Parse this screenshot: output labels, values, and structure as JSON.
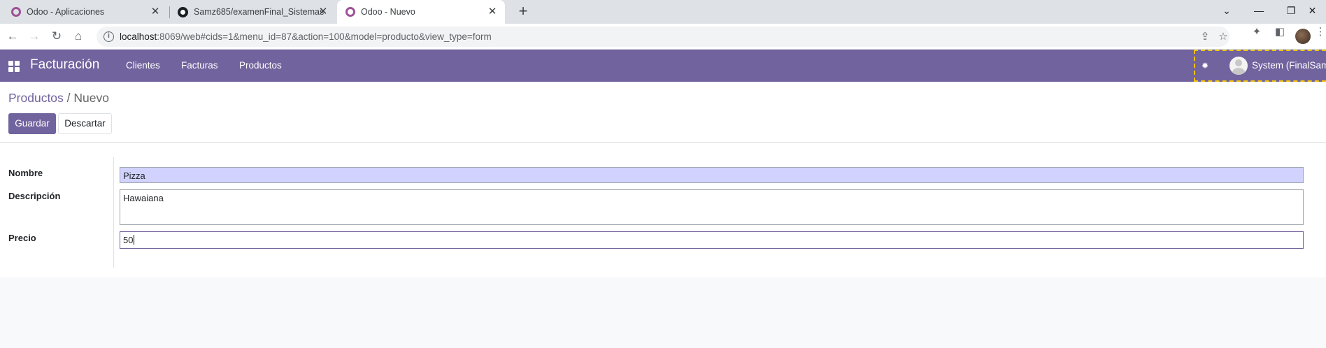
{
  "browser": {
    "tabs": [
      {
        "title": "Odoo - Aplicaciones",
        "favicon": "odoo-icon",
        "active": false
      },
      {
        "title": "Samz685/examenFinal_Sistemas",
        "favicon": "github-icon",
        "active": false
      },
      {
        "title": "Odoo - Nuevo",
        "favicon": "odoo-icon",
        "active": true
      }
    ],
    "url_host": "localhost",
    "url_rest": ":8069/web#cids=1&menu_id=87&action=100&model=producto&view_type=form"
  },
  "odoo": {
    "app_name": "Facturación",
    "menu": [
      "Clientes",
      "Facturas",
      "Productos"
    ],
    "user": "System (FinalSam",
    "accent_color": "#71639e"
  },
  "control_panel": {
    "breadcrumb_parent": "Productos",
    "breadcrumb_separator": "/",
    "breadcrumb_current": "Nuevo",
    "save_label": "Guardar",
    "discard_label": "Descartar"
  },
  "form": {
    "fields": [
      {
        "label": "Nombre",
        "value": "Pizza"
      },
      {
        "label": "Descripción",
        "value": "Hawaiana"
      },
      {
        "label": "Precio",
        "value": "50"
      }
    ]
  }
}
